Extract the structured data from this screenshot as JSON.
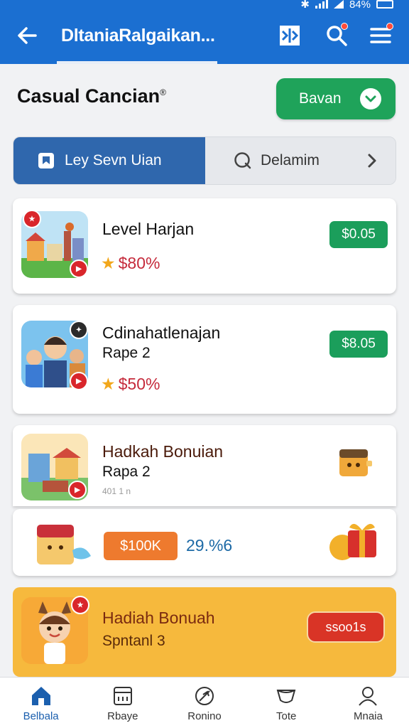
{
  "status": {
    "battery_text": "84%"
  },
  "appbar": {
    "title": "DltaniaRalgaikan..."
  },
  "header": {
    "title": "Casual Cancian",
    "title_mark": "®",
    "action_label": "Bavan"
  },
  "tabs": [
    {
      "label": "Ley Sevn Uian",
      "active": true
    },
    {
      "label": "Delamim",
      "active": false
    }
  ],
  "cards": [
    {
      "name": "Level Harjan",
      "rating": "$80%",
      "price": "$0.05"
    },
    {
      "name": "Cdinahatlenajan",
      "subtitle": "Rape 2",
      "rating": "$50%",
      "price": "$8.05"
    },
    {
      "name": "Hadkah Bonuian",
      "subtitle": "Rapa 2",
      "meta": "401 1 n"
    }
  ],
  "bundle": {
    "price_tag": "$100K",
    "percent": "29.%6"
  },
  "promo": {
    "name": "Hadiah Bonuah",
    "subtitle": "Spntanl 3",
    "button": "ssoo1s"
  },
  "bottom_nav": [
    {
      "label": "Belbala",
      "active": true
    },
    {
      "label": "Rbaye",
      "active": false
    },
    {
      "label": "Ronino",
      "active": false
    },
    {
      "label": "Tote",
      "active": false
    },
    {
      "label": "Mnaia",
      "active": false
    }
  ],
  "colors": {
    "appbar": "#1b6fd1",
    "green": "#1fa35a",
    "tab_active": "#2f67ad",
    "promo": "#f6b93d",
    "promo_button": "#d93426"
  }
}
